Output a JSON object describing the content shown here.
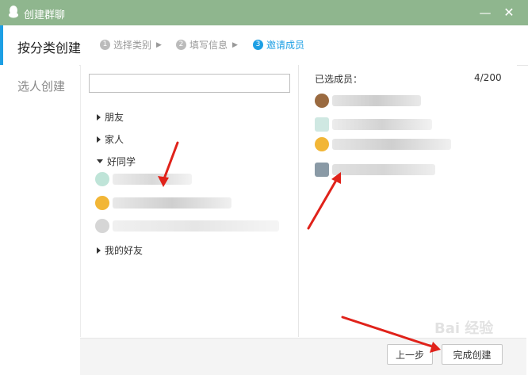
{
  "window": {
    "title": "创建群聊",
    "minimize_glyph": "—",
    "close_glyph": "✕"
  },
  "header": {
    "mode_title": "按分类创建",
    "steps": [
      {
        "num": "1",
        "label": "选择类别"
      },
      {
        "num": "2",
        "label": "填写信息"
      },
      {
        "num": "3",
        "label": "邀请成员"
      }
    ],
    "active_step": 3
  },
  "left_nav": {
    "pick_label": "选人创建"
  },
  "search": {
    "value": "",
    "placeholder": ""
  },
  "groups": [
    {
      "label": "朋友",
      "expanded": false
    },
    {
      "label": "家人",
      "expanded": false
    },
    {
      "label": "好同学",
      "expanded": true
    },
    {
      "label": "我的好友",
      "expanded": false
    }
  ],
  "selected": {
    "label": "已选成员：",
    "count": "4/200"
  },
  "footer": {
    "prev_label": "上一步",
    "done_label": "完成创建"
  },
  "watermark": "Bai 经验",
  "colors": {
    "titlebar": "#8fb68e",
    "accent": "#1d9fe4",
    "annotation": "#e0221a"
  }
}
